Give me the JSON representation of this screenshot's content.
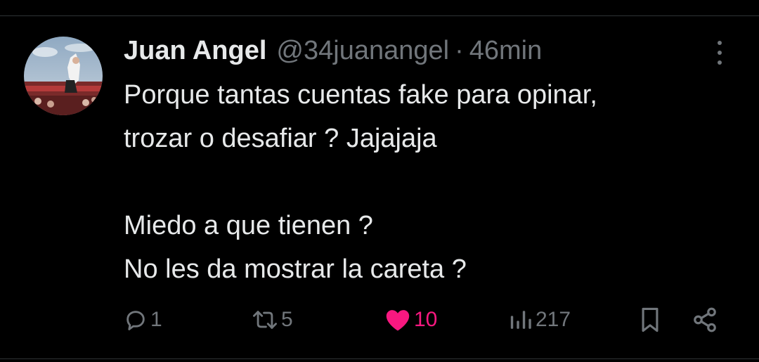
{
  "tweet": {
    "author_name": "Juan Angel",
    "handle": "@34juanangel",
    "separator": "·",
    "time": "46min",
    "lines": [
      "Porque tantas cuentas fake para opinar,",
      "trozar o desafiar ? Jajajaja",
      "",
      "Miedo a que tienen ?",
      "No les da mostrar la careta ?"
    ]
  },
  "actions": {
    "replies": "1",
    "reposts": "5",
    "likes": "10",
    "views": "217",
    "liked": true
  },
  "colors": {
    "background": "#000000",
    "text": "#e7e9ea",
    "secondary": "#71767b",
    "like": "#f91880",
    "divider": "#2f3336"
  },
  "icons": {
    "more": "more-vertical-icon",
    "reply": "reply-icon",
    "repost": "repost-icon",
    "like": "heart-icon",
    "views": "views-icon",
    "bookmark": "bookmark-icon",
    "share": "share-icon"
  }
}
